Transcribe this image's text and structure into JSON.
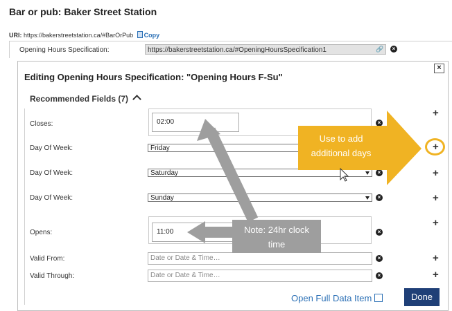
{
  "header": {
    "title": "Bar or pub:  Baker Street Station",
    "uri_label": "URI:",
    "uri_value": "https://bakerstreetstation.ca/#BarOrPub",
    "copy_label": "Copy"
  },
  "ohs_row": {
    "label": "Opening Hours Specification:",
    "value": "https://bakerstreetstation.ca/#OpeningHoursSpecification1"
  },
  "dialog": {
    "close_label": "×",
    "title": "Editing Opening Hours Specification: \"Opening Hours F-Su\"",
    "section_title": "Recommended Fields (7)",
    "fields": {
      "closes": {
        "label": "Closes:",
        "value": "02:00"
      },
      "day1": {
        "label": "Day Of Week:",
        "value": "Friday"
      },
      "day2": {
        "label": "Day Of Week:",
        "value": "Saturday"
      },
      "day3": {
        "label": "Day Of Week:",
        "value": "Sunday"
      },
      "opens": {
        "label": "Opens:",
        "value": "11:00"
      },
      "valid_from": {
        "label": "Valid From:",
        "placeholder": "Date or Date & Time…"
      },
      "valid_through": {
        "label": "Valid Through:",
        "placeholder": "Date or Date & Time…"
      }
    },
    "open_full_label": "Open Full Data Item",
    "done_label": "Done"
  },
  "annotations": {
    "callout_add_days": "Use to add additional days",
    "note_clock": "Note: 24hr clock time"
  },
  "colors": {
    "callout": "#f0b323",
    "note": "#9e9e9e",
    "primary_button": "#1f3f77",
    "link": "#2a6fb5"
  }
}
